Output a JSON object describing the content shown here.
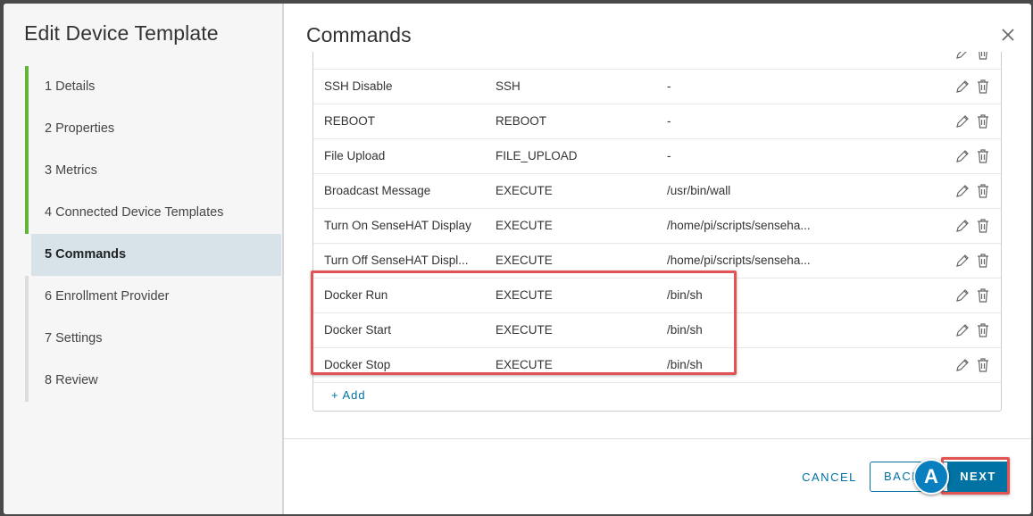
{
  "sidebar": {
    "title": "Edit Device Template",
    "steps": [
      {
        "label": "1  Details",
        "state": "done"
      },
      {
        "label": "2  Properties",
        "state": "done"
      },
      {
        "label": "3  Metrics",
        "state": "done"
      },
      {
        "label": "4  Connected Device Templates",
        "state": "done"
      },
      {
        "label": "5  Commands",
        "state": "active"
      },
      {
        "label": "6  Enrollment Provider",
        "state": "todo"
      },
      {
        "label": "7  Settings",
        "state": "todo"
      },
      {
        "label": "8  Review",
        "state": "todo"
      }
    ]
  },
  "main": {
    "title": "Commands",
    "rows": [
      {
        "name": "SSH Disable",
        "type": "SSH",
        "command": "-"
      },
      {
        "name": "REBOOT",
        "type": "REBOOT",
        "command": "-"
      },
      {
        "name": "File Upload",
        "type": "FILE_UPLOAD",
        "command": "-"
      },
      {
        "name": "Broadcast Message",
        "type": "EXECUTE",
        "command": "/usr/bin/wall"
      },
      {
        "name": "Turn On SenseHAT Display",
        "type": "EXECUTE",
        "command": "/home/pi/scripts/senseha..."
      },
      {
        "name": "Turn Off SenseHAT Displ...",
        "type": "EXECUTE",
        "command": "/home/pi/scripts/senseha..."
      },
      {
        "name": "Docker Run",
        "type": "EXECUTE",
        "command": "/bin/sh"
      },
      {
        "name": "Docker Start",
        "type": "EXECUTE",
        "command": "/bin/sh"
      },
      {
        "name": "Docker Stop",
        "type": "EXECUTE",
        "command": "/bin/sh"
      }
    ],
    "add_label": "+ Add"
  },
  "footer": {
    "cancel_label": "CANCEL",
    "back_label": "BACK",
    "next_label": "NEXT"
  },
  "annotation": {
    "marker_label": "A"
  },
  "colors": {
    "accent": "#0072a3",
    "done": "#62b536",
    "highlight": "#e05554",
    "active_step_bg": "#d8e3e9"
  }
}
